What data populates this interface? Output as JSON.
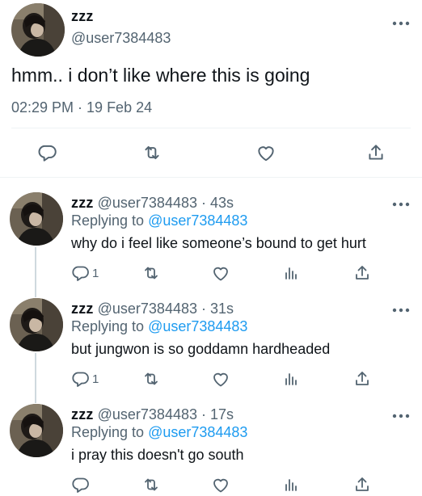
{
  "icons": {
    "avatar": "avatar-photo",
    "more": "more-horizontal-icon",
    "reply": "reply-bubble-icon",
    "retweet": "retweet-icon",
    "like": "heart-icon",
    "views": "analytics-bars-icon",
    "share": "share-upload-icon"
  },
  "colors": {
    "text": "#0f1419",
    "secondary": "#536471",
    "link": "#1d9bf0",
    "divider": "#eff3f4",
    "thread_line": "#cfd9de"
  },
  "main_tweet": {
    "display_name": "zzz",
    "handle": "@user7384483",
    "text": "hmm.. i don’t like where this is going",
    "timestamp": "02:29 PM · 19 Feb 24"
  },
  "replies": [
    {
      "display_name": "zzz",
      "meta": "@user7384483 · 43s",
      "replying_label": "Replying to",
      "replying_handle": "@user7384483",
      "text": "why do i feel like someone’s bound to get hurt",
      "reply_count": "1"
    },
    {
      "display_name": "zzz",
      "meta": "@user7384483 · 31s",
      "replying_label": "Replying to",
      "replying_handle": "@user7384483",
      "text": "but jungwon is so goddamn hardheaded",
      "reply_count": "1"
    },
    {
      "display_name": "zzz",
      "meta": "@user7384483 · 17s",
      "replying_label": "Replying to",
      "replying_handle": "@user7384483",
      "text": "i pray this doesn't go south",
      "reply_count": ""
    }
  ]
}
